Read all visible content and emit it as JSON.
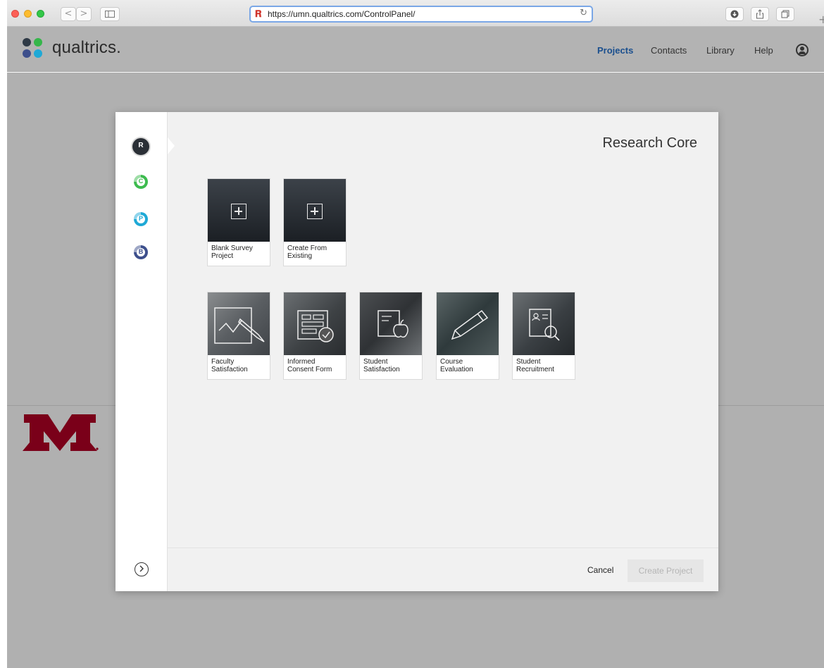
{
  "browser": {
    "url": "https://umn.qualtrics.com/ControlPanel/",
    "back_glyph": "<",
    "forward_glyph": ">",
    "reload_glyph": "↻",
    "new_tab_glyph": "+"
  },
  "app": {
    "logo_text": "qualtrics.",
    "logo_colors": [
      "#2f3a46",
      "#35b64a",
      "#1fa9d6",
      "#3d4f8c"
    ],
    "nav": [
      "Projects",
      "Contacts",
      "Library",
      "Help"
    ],
    "active_nav": "Projects"
  },
  "modal": {
    "title": "Research Core",
    "side_icons": [
      {
        "letter": "R",
        "name": "research-core-icon"
      },
      {
        "letter": "C",
        "name": "customer-experience-icon"
      },
      {
        "letter": "P",
        "name": "employee-experience-icon"
      },
      {
        "letter": "B",
        "name": "brand-experience-icon"
      }
    ],
    "tiles_row1": [
      {
        "label": "Blank Survey\nProject"
      },
      {
        "label": "Create From\nExisting"
      }
    ],
    "tiles_row2": [
      {
        "label": "Faculty\nSatisfaction"
      },
      {
        "label": "Informed\nConsent Form"
      },
      {
        "label": "Student\nSatisfaction"
      },
      {
        "label": "Course\nEvaluation"
      },
      {
        "label": "Student\nRecruitment"
      }
    ],
    "cancel_label": "Cancel",
    "create_label": "Create Project"
  },
  "colors": {
    "accent": "#1a4f8e",
    "umn_maroon": "#7a0019"
  }
}
